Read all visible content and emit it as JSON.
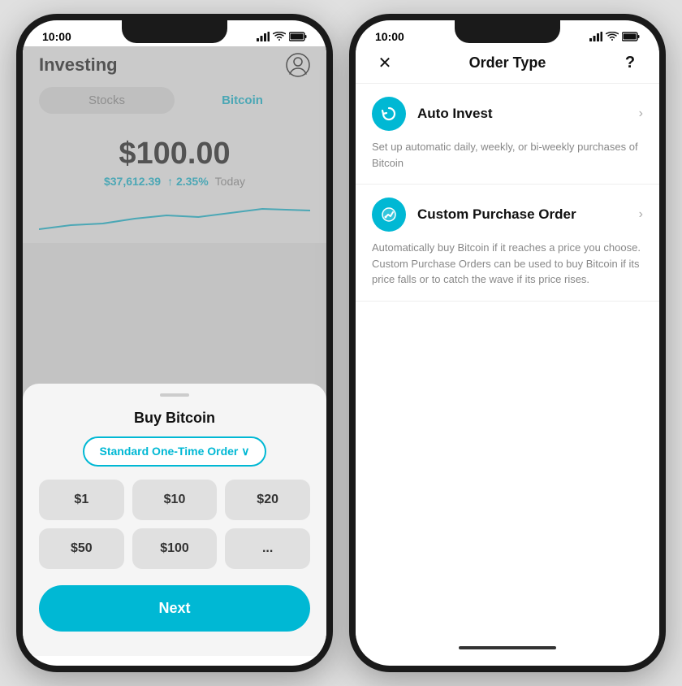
{
  "left": {
    "status": {
      "time": "10:00",
      "signal": "▂▄▆",
      "wifi": "wifi",
      "battery": "battery"
    },
    "header": {
      "title": "Investing",
      "profile_icon": "person-icon"
    },
    "tabs": [
      {
        "label": "Stocks",
        "active": false
      },
      {
        "label": "Bitcoin",
        "active": true
      }
    ],
    "price": {
      "amount": "$100.00",
      "btc_price": "$37,612.39",
      "change": "↑ 2.35%",
      "period": "Today"
    },
    "sheet": {
      "title": "Buy Bitcoin",
      "order_type": "Standard One-Time Order ∨",
      "presets": [
        "$1",
        "$10",
        "$20",
        "$50",
        "$100",
        "..."
      ],
      "next_label": "Next"
    }
  },
  "right": {
    "status": {
      "time": "10:00"
    },
    "header": {
      "close": "✕",
      "title": "Order Type",
      "help": "?"
    },
    "options": [
      {
        "id": "auto-invest",
        "icon_char": "↻",
        "title": "Auto Invest",
        "description": "Set up automatic daily, weekly, or bi-weekly purchases of Bitcoin"
      },
      {
        "id": "custom-purchase",
        "icon_char": "⚡",
        "title": "Custom Purchase Order",
        "description": "Automatically buy Bitcoin if it reaches a price you choose. Custom Purchase Orders can be used to buy Bitcoin if its price falls or to catch the wave if its price rises."
      }
    ]
  }
}
